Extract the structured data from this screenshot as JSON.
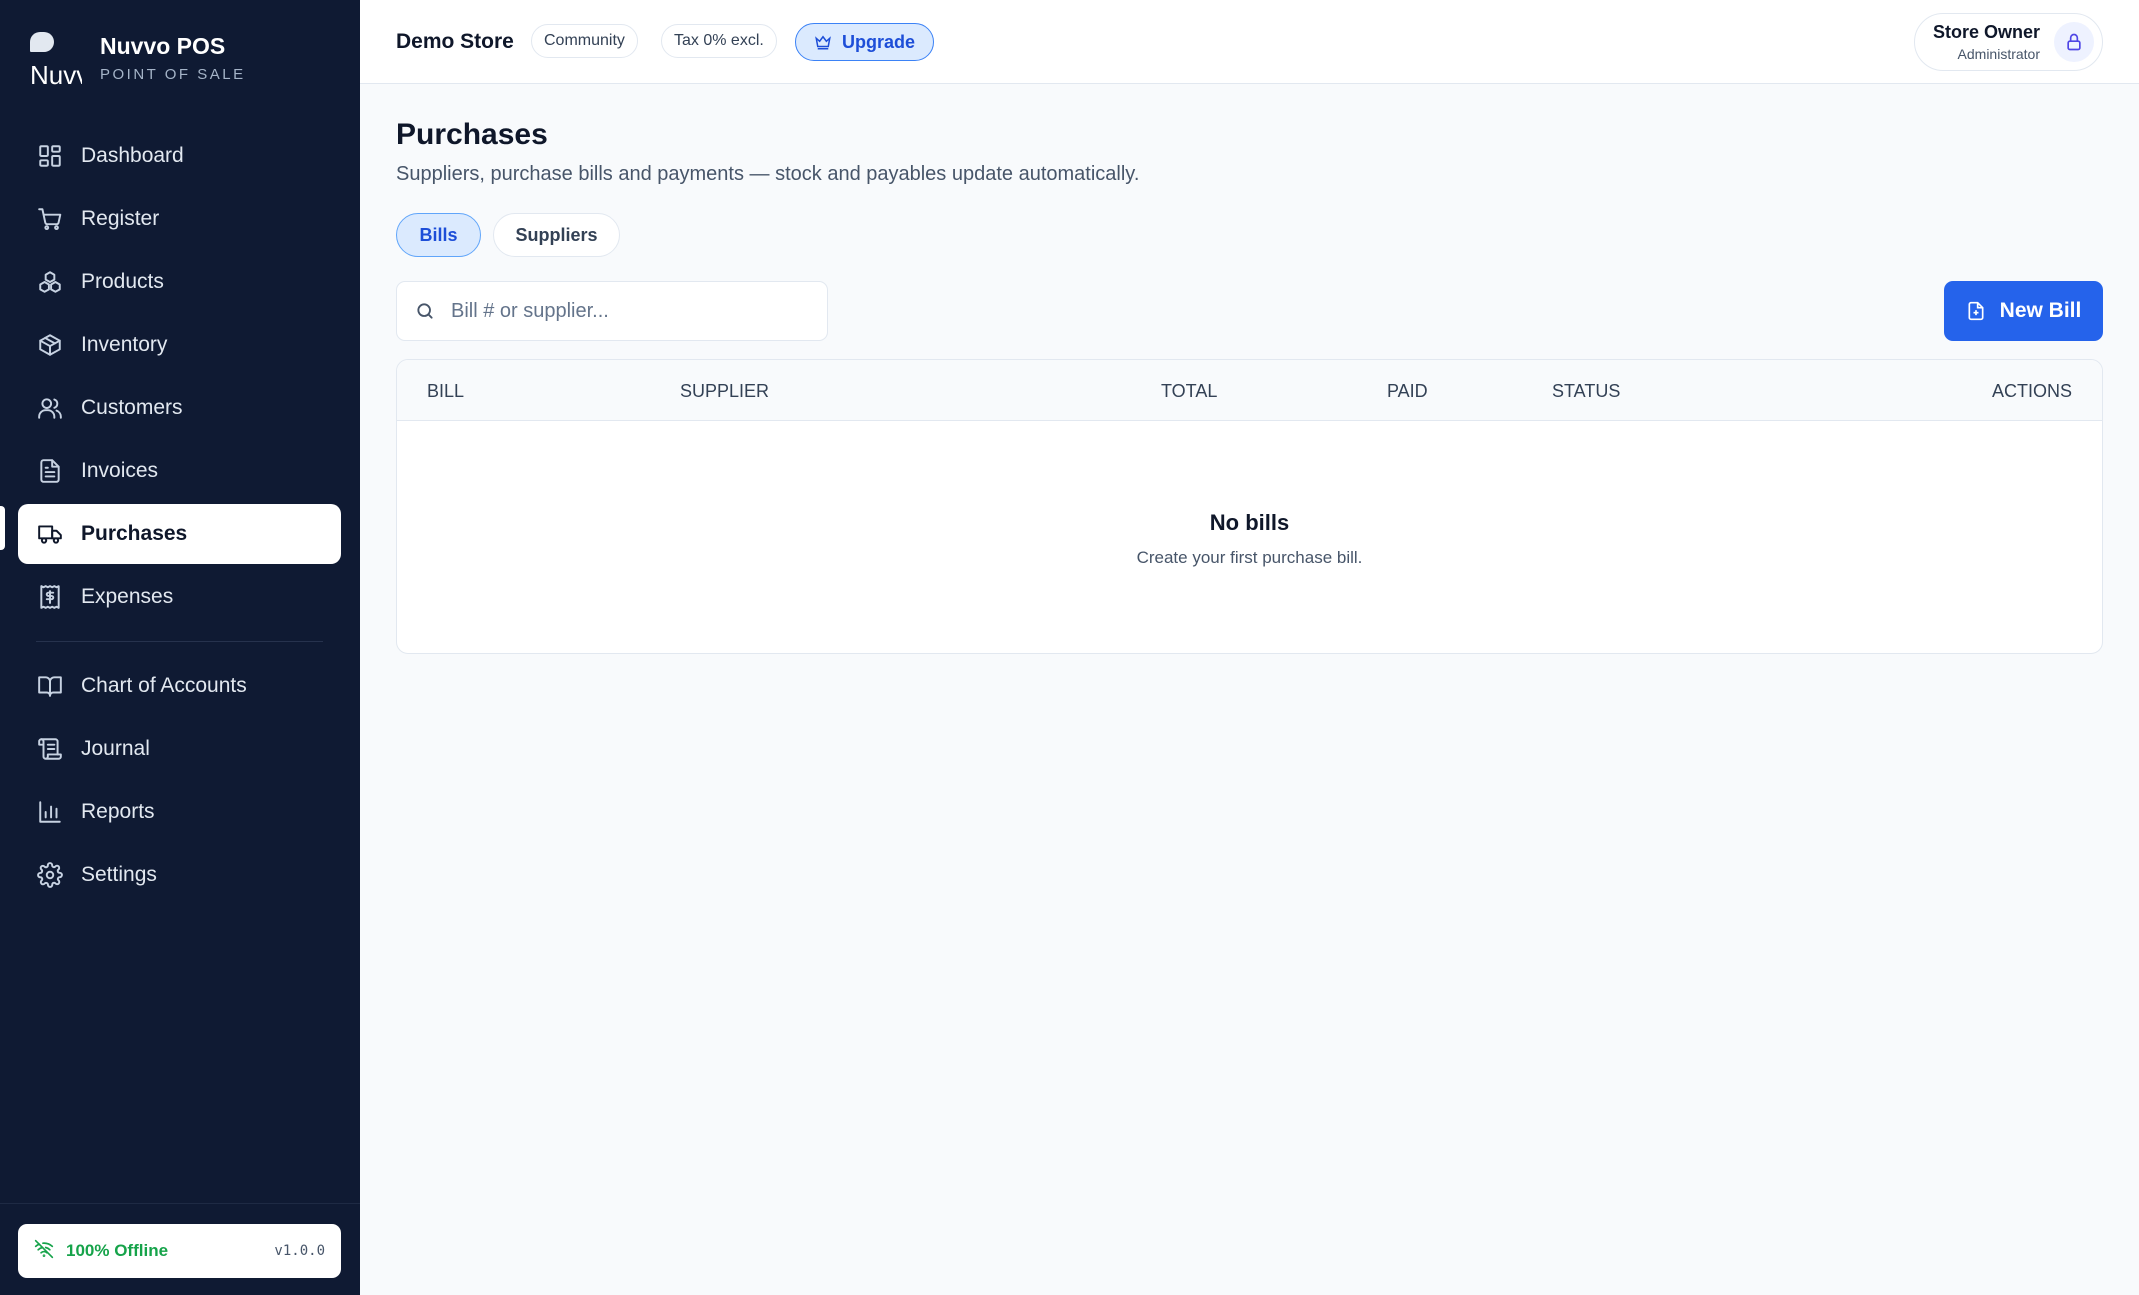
{
  "brand": {
    "logo_alt": "Nuvvo POS",
    "title": "Nuvvo POS",
    "subtitle": "POINT OF SALE"
  },
  "sidebar": {
    "items": [
      {
        "label": "Dashboard",
        "icon": "layout-grid-icon"
      },
      {
        "label": "Register",
        "icon": "shopping-cart-icon"
      },
      {
        "label": "Products",
        "icon": "boxes-icon"
      },
      {
        "label": "Inventory",
        "icon": "package-icon"
      },
      {
        "label": "Customers",
        "icon": "users-icon"
      },
      {
        "label": "Invoices",
        "icon": "file-text-icon"
      },
      {
        "label": "Purchases",
        "icon": "truck-icon",
        "active": true
      },
      {
        "label": "Expenses",
        "icon": "receipt-dollar-icon"
      }
    ],
    "accounting_items": [
      {
        "label": "Chart of Accounts",
        "icon": "book-open-icon"
      },
      {
        "label": "Journal",
        "icon": "scroll-icon"
      },
      {
        "label": "Reports",
        "icon": "bar-chart-icon"
      },
      {
        "label": "Settings",
        "icon": "gear-icon"
      }
    ],
    "footer": {
      "status": "100% Offline",
      "version": "v1.0.0"
    }
  },
  "topbar": {
    "store_name": "Demo Store",
    "plan_badge": "Community",
    "tax_badge": "Tax 0% excl.",
    "upgrade_label": "Upgrade",
    "user_name": "Store Owner",
    "user_role": "Administrator"
  },
  "page": {
    "title": "Purchases",
    "subtitle": "Suppliers, purchase bills and payments — stock and payables update automatically.",
    "tabs": [
      {
        "label": "Bills",
        "active": true
      },
      {
        "label": "Suppliers",
        "active": false
      }
    ],
    "search_placeholder": "Bill # or supplier...",
    "new_button": "New Bill"
  },
  "table": {
    "columns": [
      "BILL",
      "SUPPLIER",
      "TOTAL",
      "PAID",
      "STATUS",
      "ACTIONS"
    ],
    "rows": [],
    "empty_title": "No bills",
    "empty_subtitle": "Create your first purchase bill."
  },
  "colors": {
    "sidebar_bg": "#0f1a33",
    "accent": "#2563eb",
    "offline_green": "#16a34a"
  }
}
